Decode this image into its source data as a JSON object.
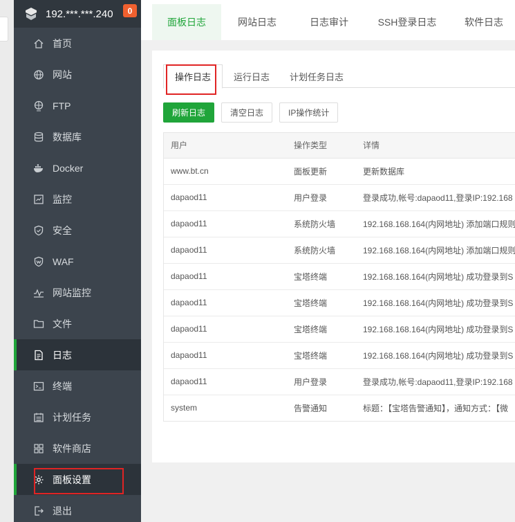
{
  "server": {
    "ip": "192.***.***.240",
    "badge": "0"
  },
  "sidebar": {
    "items": [
      {
        "label": "首页",
        "icon": "home-icon"
      },
      {
        "label": "网站",
        "icon": "globe-icon"
      },
      {
        "label": "FTP",
        "icon": "ftp-globe-icon"
      },
      {
        "label": "数据库",
        "icon": "database-icon"
      },
      {
        "label": "Docker",
        "icon": "docker-icon"
      },
      {
        "label": "监控",
        "icon": "monitor-icon"
      },
      {
        "label": "安全",
        "icon": "shield-icon"
      },
      {
        "label": "WAF",
        "icon": "waf-shield-icon"
      },
      {
        "label": "网站监控",
        "icon": "site-monitor-icon"
      },
      {
        "label": "文件",
        "icon": "folder-icon"
      },
      {
        "label": "日志",
        "icon": "log-icon"
      },
      {
        "label": "终端",
        "icon": "terminal-icon"
      },
      {
        "label": "计划任务",
        "icon": "calendar-icon"
      },
      {
        "label": "软件商店",
        "icon": "apps-grid-icon"
      },
      {
        "label": "面板设置",
        "icon": "gear-icon"
      },
      {
        "label": "退出",
        "icon": "logout-icon"
      }
    ]
  },
  "top_tabs": [
    "面板日志",
    "网站日志",
    "日志审计",
    "SSH登录日志",
    "软件日志"
  ],
  "sub_tabs": [
    "操作日志",
    "运行日志",
    "计划任务日志"
  ],
  "actions": {
    "refresh": "刷新日志",
    "clear": "清空日志",
    "ip_stats": "IP操作统计"
  },
  "table": {
    "headers": [
      "用户",
      "操作类型",
      "详情"
    ],
    "rows": [
      [
        "www.bt.cn",
        "面板更新",
        "更新数据库"
      ],
      [
        "dapaod11",
        "用户登录",
        "登录成功,帐号:dapaod11,登录IP:192.168"
      ],
      [
        "dapaod11",
        "系统防火墙",
        "192.168.168.164(内网地址) 添加端口规则"
      ],
      [
        "dapaod11",
        "系统防火墙",
        "192.168.168.164(内网地址) 添加端口规则"
      ],
      [
        "dapaod11",
        "宝塔终端",
        "192.168.168.164(内网地址) 成功登录到S"
      ],
      [
        "dapaod11",
        "宝塔终端",
        "192.168.168.164(内网地址) 成功登录到S"
      ],
      [
        "dapaod11",
        "宝塔终端",
        "192.168.168.164(内网地址) 成功登录到S"
      ],
      [
        "dapaod11",
        "宝塔终端",
        "192.168.168.164(内网地址) 成功登录到S"
      ],
      [
        "dapaod11",
        "用户登录",
        "登录成功,帐号:dapaod11,登录IP:192.168"
      ],
      [
        "system",
        "告警通知",
        "标题：【宝塔告警通知】，通知方式：【微"
      ]
    ]
  },
  "colors": {
    "accent": "#20a53a",
    "sidebar_bg": "#3c444d",
    "highlight_box": "#e02424",
    "badge": "#f0602f"
  }
}
